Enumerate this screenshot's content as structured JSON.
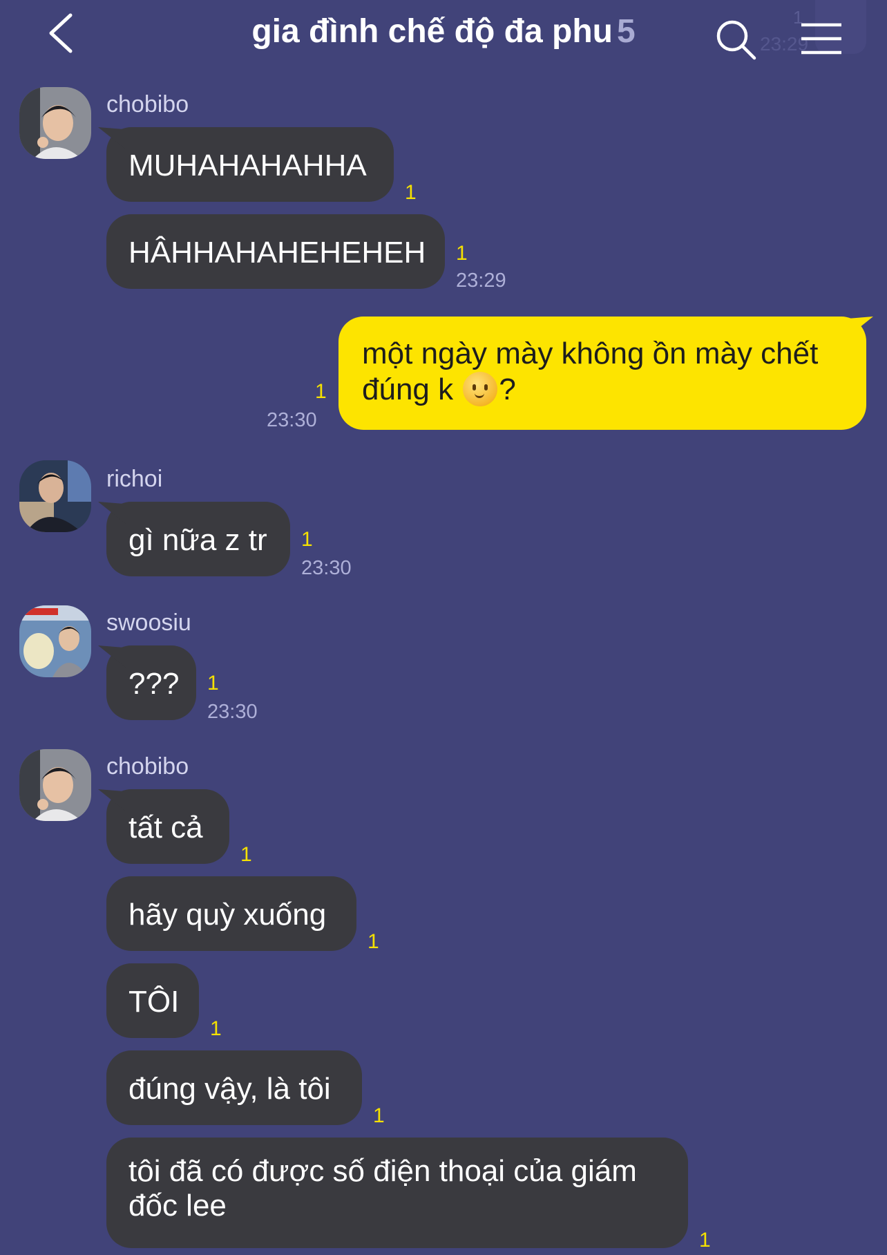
{
  "header": {
    "title": "gia đình chế độ đa phu",
    "member_count": "5",
    "icons": [
      "chevron-left-icon",
      "search-icon",
      "hamburger-menu-icon"
    ]
  },
  "overlay": {
    "unread": "1",
    "time": "23:29"
  },
  "colors": {
    "background": "#414379",
    "bubble_other": "#3a3a3f",
    "bubble_mine": "#fde400",
    "unread": "#f5e100",
    "time": "#aeb0d8"
  },
  "messages": [
    {
      "sender": "chobibo",
      "text": "MUHAHAHAHHA",
      "unread": "1",
      "time": ""
    },
    {
      "sender": "chobibo",
      "text": "HÂHHAHAHEHEHEH",
      "unread": "1",
      "time": "23:29"
    },
    {
      "sender": "me",
      "text_line1": "một ngày mày không ồn mày chết",
      "text_line2_before": "đúng k ",
      "emoji": "slightly-smiling-face-emoji",
      "text_line2_after": "?",
      "unread": "1",
      "time": "23:30"
    },
    {
      "sender": "richoi",
      "text": "gì nữa z tr",
      "unread": "1",
      "time": "23:30"
    },
    {
      "sender": "swoosiu",
      "text": "???",
      "unread": "1",
      "time": "23:30"
    },
    {
      "sender": "chobibo",
      "text": "tất cả",
      "unread": "1",
      "time": ""
    },
    {
      "sender": "chobibo",
      "text": "hãy quỳ xuống",
      "unread": "1",
      "time": ""
    },
    {
      "sender": "chobibo",
      "text": "TÔI",
      "unread": "1",
      "time": ""
    },
    {
      "sender": "chobibo",
      "text": "đúng vậy, là tôi",
      "unread": "1",
      "time": ""
    },
    {
      "sender": "chobibo",
      "text": "tôi đã có được số điện thoại của giám đốc lee",
      "unread": "1",
      "time": ""
    }
  ]
}
